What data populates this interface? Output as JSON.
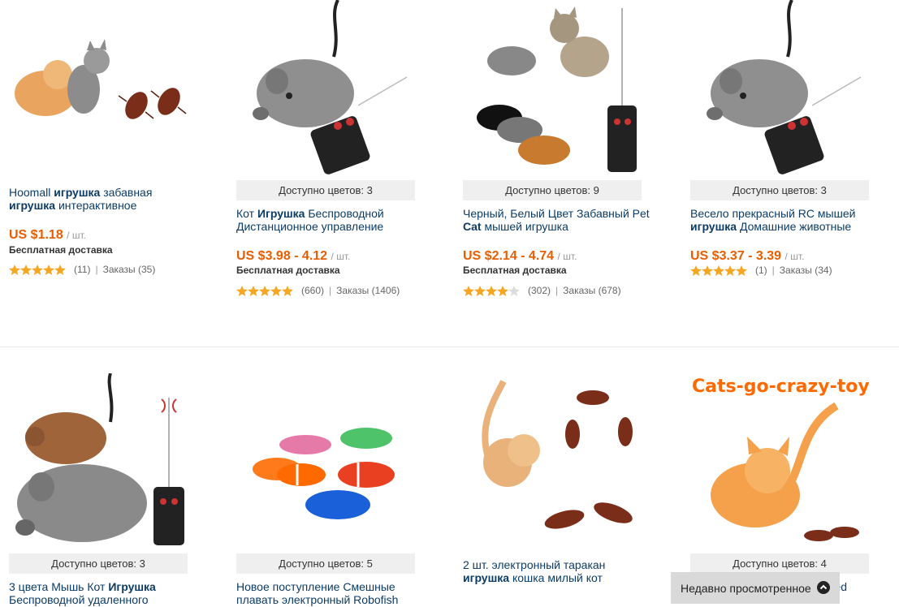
{
  "products": [
    {
      "title_parts": [
        "Hoomall ",
        "игрушка",
        " забавная ",
        "игрушка",
        " интерактивное"
      ],
      "price": "US $1.18",
      "unit": "/ шт.",
      "shipping": "Бесплатная доставка",
      "rating_count": "(11)",
      "orders": "Заказы (35)",
      "colors": ""
    },
    {
      "title_parts": [
        "Кот ",
        "Игрушка",
        " Беспроводной Дистанционное управление",
        "",
        ""
      ],
      "price": "US $3.98 - 4.12",
      "unit": "/ шт.",
      "shipping": "Бесплатная доставка",
      "rating_count": "(660)",
      "orders": "Заказы (1406)",
      "colors": "Доступно цветов: 3"
    },
    {
      "title_parts": [
        "Черный, Белый Цвет Забавный Pet ",
        "Cat",
        " мышей игрушка",
        "",
        ""
      ],
      "price": "US $2.14 - 4.74",
      "unit": "/ шт.",
      "shipping": "Бесплатная доставка",
      "rating_count": "(302)",
      "orders": "Заказы (678)",
      "colors": "Доступно цветов: 9"
    },
    {
      "title_parts": [
        "Весело прекрасный RC мышей ",
        "игрушка",
        " Домашние животные",
        "",
        ""
      ],
      "price": "US $3.37 - 3.39",
      "unit": "/ шт.",
      "shipping": "",
      "rating_count": "(1)",
      "orders": "Заказы (34)",
      "colors": "Доступно цветов: 3"
    },
    {
      "title_parts": [
        "3 цвета Мышь Кот ",
        "Игрушка",
        " Беспроводной удаленного",
        "",
        ""
      ],
      "colors": "Доступно цветов: 3"
    },
    {
      "title_parts": [
        "Новое поступление Смешные плавать электронный Robofish",
        "",
        "",
        "",
        ""
      ],
      "colors": "Доступно цветов: 5"
    },
    {
      "title_parts": [
        "2 шт. электронный таракан ",
        "игрушка",
        " кошка милый кот",
        "",
        ""
      ],
      "colors": ""
    },
    {
      "title_parts": [
        "",
        "",
        "",
        "",
        "ered"
      ],
      "colors": "Доступно цветов: 4",
      "banner": "Cats-go-crazy-toy"
    }
  ],
  "recent": {
    "label": "Недавно просмотренное"
  },
  "colors_theme": {
    "accent": "#e85d00",
    "link": "#0c3c66",
    "star": "#f5a623"
  }
}
